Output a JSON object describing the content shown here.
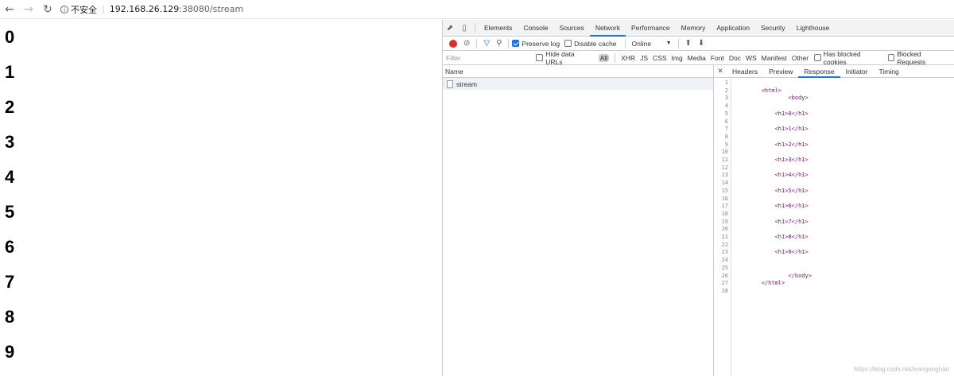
{
  "browser": {
    "security_label": "不安全",
    "url_host": "192.168.26.129",
    "url_rest": ":38080/stream"
  },
  "page": {
    "headings": [
      "0",
      "1",
      "2",
      "3",
      "4",
      "5",
      "6",
      "7",
      "8",
      "9"
    ]
  },
  "devtools": {
    "tabs": [
      "Elements",
      "Console",
      "Sources",
      "Network",
      "Performance",
      "Memory",
      "Application",
      "Security",
      "Lighthouse"
    ],
    "active_tab": "Network",
    "controls": {
      "preserve_log": "Preserve log",
      "disable_cache": "Disable cache",
      "throttle": "Online"
    },
    "filter": {
      "placeholder": "Filter",
      "hide_data_urls": "Hide data URLs",
      "types": [
        "All",
        "XHR",
        "JS",
        "CSS",
        "Img",
        "Media",
        "Font",
        "Doc",
        "WS",
        "Manifest",
        "Other"
      ],
      "has_blocked_cookies": "Has blocked cookies",
      "blocked_requests": "Blocked Requests"
    },
    "netlist": {
      "header": "Name",
      "rows": [
        "stream"
      ]
    },
    "detail_tabs": [
      "Headers",
      "Preview",
      "Response",
      "Initiator",
      "Timing"
    ],
    "active_detail_tab": "Response",
    "response_lines": [
      "",
      "        <html>",
      "                <body>",
      "",
      "            <h1>0</h1>",
      "",
      "            <h1>1</h1>",
      "",
      "            <h1>2</h1>",
      "",
      "            <h1>3</h1>",
      "",
      "            <h1>4</h1>",
      "",
      "            <h1>5</h1>",
      "",
      "            <h1>6</h1>",
      "",
      "            <h1>7</h1>",
      "",
      "            <h1>8</h1>",
      "",
      "            <h1>9</h1>",
      "",
      "",
      "                </body>",
      "        </html>",
      ""
    ]
  },
  "watermark": "https://blog.csdn.net/wangonghan"
}
